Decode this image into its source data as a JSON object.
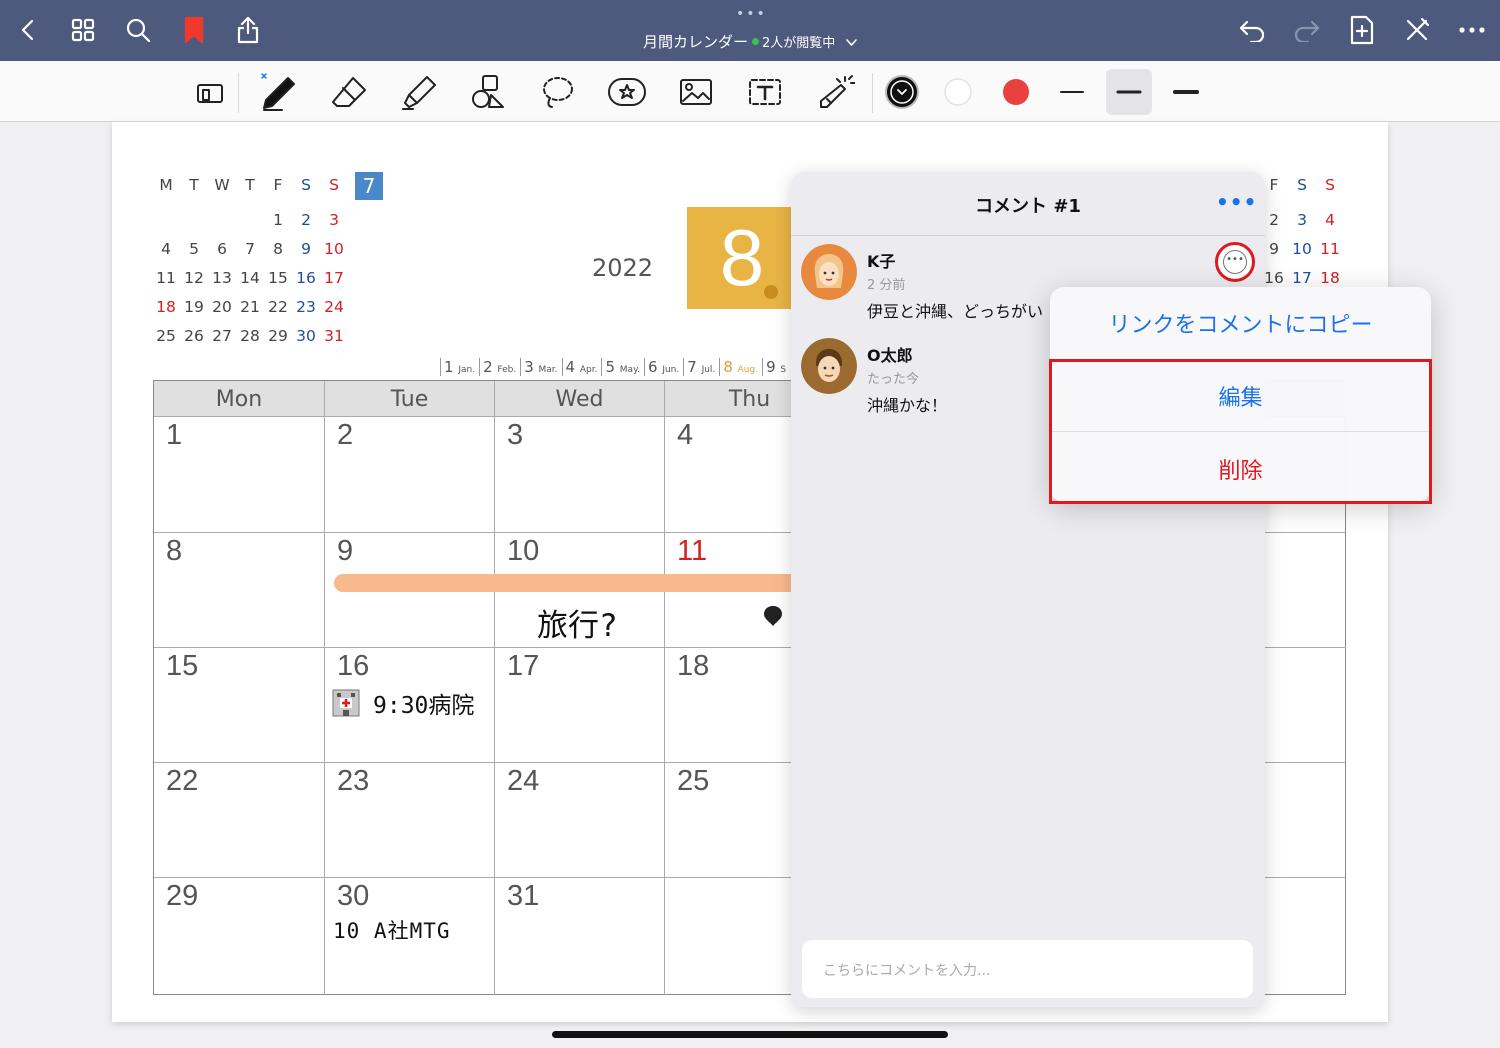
{
  "topbar": {
    "title": "月間カレンダー",
    "viewers": "2人が閲覧中",
    "icons": [
      "back-icon",
      "grid-icon",
      "search-icon",
      "bookmark-icon",
      "share-icon",
      "undo-icon",
      "redo-icon",
      "add-page-icon",
      "close-pen-icon",
      "more-icon"
    ],
    "bookmark_color": "#f0392b",
    "bg_color": "#4d5a7e"
  },
  "toolbar": {
    "tools": [
      "screen-mode-icon",
      "pen-icon",
      "eraser-icon",
      "highlighter-icon",
      "shapes-icon",
      "lasso-icon",
      "sticker-icon",
      "image-icon",
      "text-icon",
      "laser-icon"
    ],
    "colors": [
      "#111111",
      "#ffffff",
      "#e8413e"
    ]
  },
  "page": {
    "year": "2022",
    "month": "8",
    "mini_july": {
      "headers": [
        "M",
        "T",
        "W",
        "T",
        "F",
        "S",
        "S"
      ],
      "month_label": "7",
      "rows": [
        [
          "",
          "",
          "",
          "",
          "1",
          "2",
          "3"
        ],
        [
          "4",
          "5",
          "6",
          "7",
          "8",
          "9",
          "10"
        ],
        [
          "11",
          "12",
          "13",
          "14",
          "15",
          "16",
          "17"
        ],
        [
          "18",
          "19",
          "20",
          "21",
          "22",
          "23",
          "24"
        ],
        [
          "25",
          "26",
          "27",
          "28",
          "29",
          "30",
          "31"
        ]
      ]
    },
    "mini_sep": {
      "headers": [
        "F",
        "S",
        "S"
      ],
      "rows": [
        [
          "2",
          "3",
          "4"
        ],
        [
          "9",
          "10",
          "11"
        ],
        [
          "16",
          "17",
          "18"
        ]
      ]
    },
    "month_strip": [
      {
        "n": "1",
        "abbr": "Jan."
      },
      {
        "n": "2",
        "abbr": "Feb."
      },
      {
        "n": "3",
        "abbr": "Mar."
      },
      {
        "n": "4",
        "abbr": "Apr."
      },
      {
        "n": "5",
        "abbr": "May."
      },
      {
        "n": "6",
        "abbr": "Jun."
      },
      {
        "n": "7",
        "abbr": "Jul."
      },
      {
        "n": "8",
        "abbr": "Aug."
      },
      {
        "n": "9",
        "abbr": "S"
      }
    ],
    "weekday_headers": [
      "Mon",
      "Tue",
      "Wed",
      "Thu"
    ],
    "weeks": [
      [
        "1",
        "2",
        "3",
        "4"
      ],
      [
        "8",
        "9",
        "10",
        "11"
      ],
      [
        "15",
        "16",
        "17",
        "18"
      ],
      [
        "22",
        "23",
        "24",
        "25"
      ],
      [
        "29",
        "30",
        "31",
        ""
      ]
    ],
    "notes": {
      "trip": "旅行?",
      "hospital": "9:30病院",
      "meeting": "10 A社MTG"
    }
  },
  "comments": {
    "title": "コメント #1",
    "more": "•••",
    "items": [
      {
        "name": "K子",
        "time": "2 分前",
        "body": "伊豆と沖縄、どっちがい"
      },
      {
        "name": "O太郎",
        "time": "たった今",
        "body": "沖縄かな！"
      }
    ],
    "input_placeholder": "こちらにコメントを入力..."
  },
  "context_menu": {
    "copy_link": "リンクをコメントにコピー",
    "edit": "編集",
    "delete": "削除"
  }
}
